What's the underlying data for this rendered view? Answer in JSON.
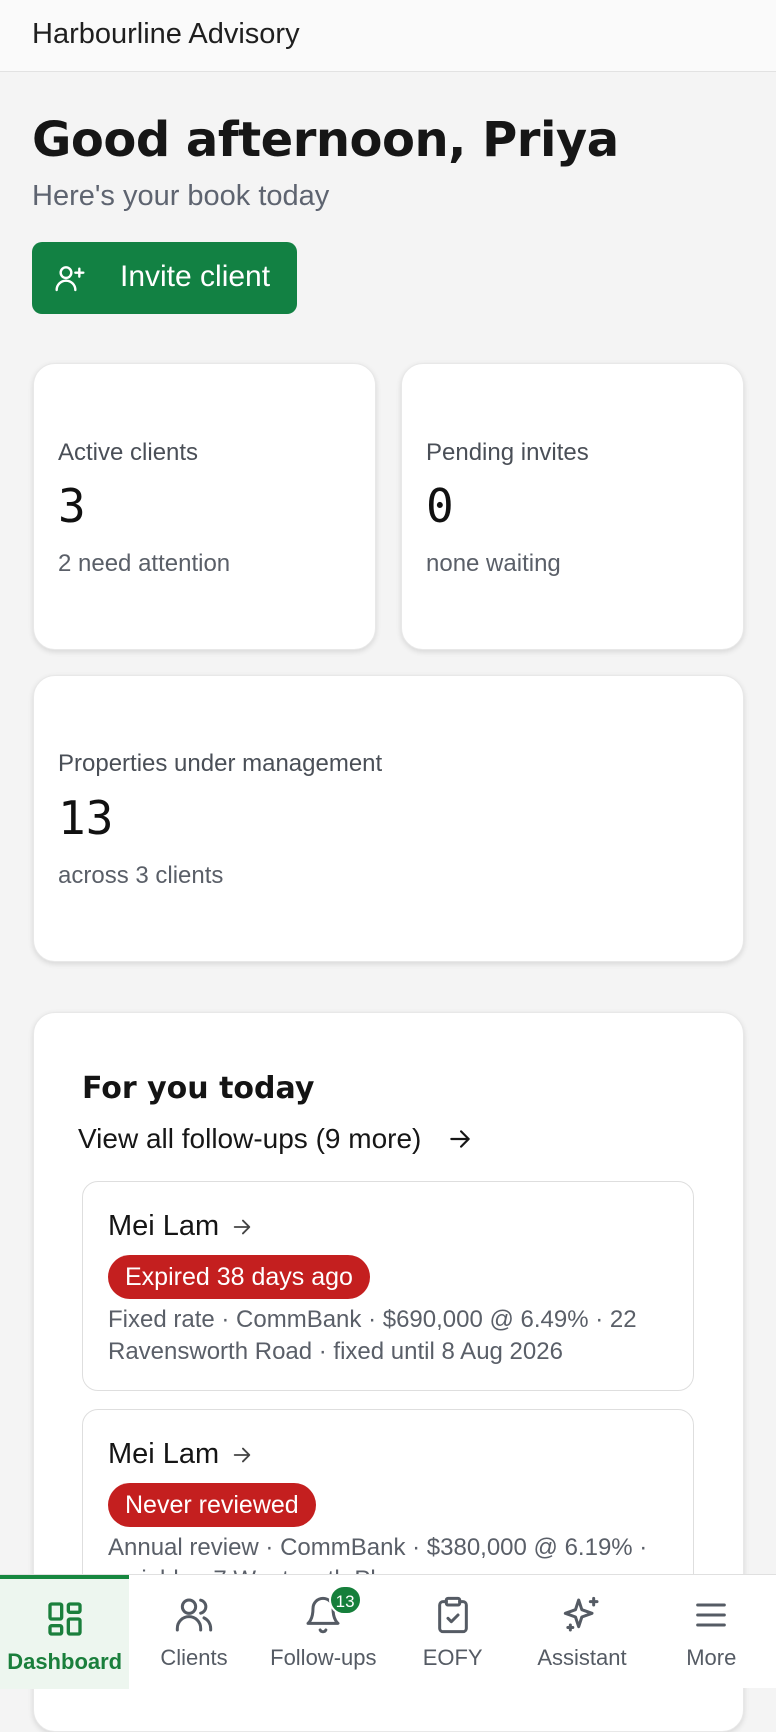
{
  "app": {
    "title": "Harbourline Advisory"
  },
  "header": {
    "greeting": "Good afternoon, Priya",
    "subtitle": "Here's your book today"
  },
  "invite_button": {
    "label": "Invite client",
    "icon": "user-plus-icon"
  },
  "stats": {
    "active_clients": {
      "label": "Active clients",
      "value": "3",
      "sub": "2 need attention"
    },
    "pending_invites": {
      "label": "Pending invites",
      "value": "0",
      "sub": "none waiting"
    },
    "properties": {
      "label": "Properties under management",
      "value": "13",
      "sub": "across 3 clients"
    }
  },
  "followups": {
    "title": "For you today",
    "view_all": "View all follow-ups (9 more)",
    "items": [
      {
        "name": "Mei Lam",
        "badge": "Expired 38 days ago",
        "detail": "Fixed rate · CommBank · $690,000 @ 6.49% · 22 Ravensworth Road · fixed until 8 Aug 2026"
      },
      {
        "name": "Mei Lam",
        "badge": "Never reviewed",
        "detail": "Annual review · CommBank · $380,000 @ 6.19% · variable · 7 Wentworth Pl"
      }
    ]
  },
  "nav": {
    "items": [
      {
        "label": "Dashboard",
        "icon": "dashboard-icon",
        "active": true
      },
      {
        "label": "Clients",
        "icon": "users-icon"
      },
      {
        "label": "Follow-ups",
        "icon": "bell-icon",
        "badge": "13"
      },
      {
        "label": "EOFY",
        "icon": "clipboard-check-icon"
      },
      {
        "label": "Assistant",
        "icon": "sparkles-icon"
      },
      {
        "label": "More",
        "icon": "menu-icon"
      }
    ]
  },
  "colors": {
    "primary": "#128143",
    "badge_red": "#c41f1f",
    "nav_active_bg": "#edf6ef"
  }
}
